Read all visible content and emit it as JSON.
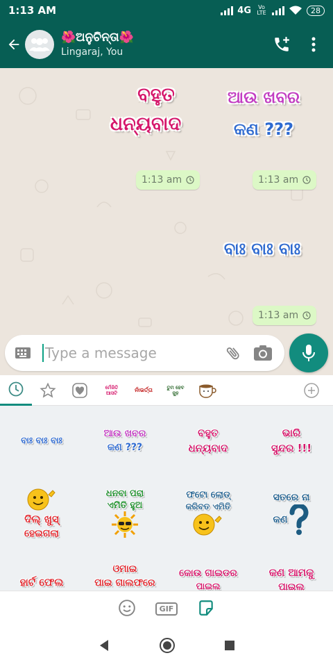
{
  "status_bar": {
    "time": "1:13 AM",
    "network": "4G",
    "volte": "Vo LTE",
    "battery": "28"
  },
  "header": {
    "group_name": "🌺ଅନୁଚିନ୍ତା🌺",
    "members": "Lingaraj, You"
  },
  "chat": {
    "stickers": [
      {
        "line1": "ବହୁତ",
        "line2": "ଧନ୍ୟବାଦ"
      },
      {
        "line1": "ଆଉ ଖବର",
        "line2": "କଣ ???"
      },
      {
        "line1": "ବାଃ ବାଃ ବାଃ"
      }
    ],
    "timestamps": [
      "1:13 am",
      "1:13 am",
      "1:13 am"
    ]
  },
  "composer": {
    "placeholder": "Type a message"
  },
  "tray": {
    "tab_labels": [
      {
        "line1": "ମେଁଜିତି",
        "line2": "ଆସଟି"
      },
      {
        "line1": "ନାଁଭର୍ତ୍ତା"
      },
      {
        "line1": "ତୁମ ହେବ",
        "line2": "ଜୁହ"
      }
    ],
    "grid": [
      {
        "line1": "ବାଃ ବାଃ ବାଃ"
      },
      {
        "line1": "ଆଉ ଖବର",
        "line2": "କଣ ???"
      },
      {
        "line1": "ବହୁତ",
        "line2": "ଧନ୍ୟବାଦ"
      },
      {
        "line1": "ଭାରି",
        "line2": "ସୁନ୍ଦର !!!"
      },
      {
        "line1": "ଦିଲ୍ ଖୁସ୍",
        "line2": "ହେଇଗଲା"
      },
      {
        "line1": "ଧନବା ପରା",
        "line2": "ଏମିତି ହୁଅ"
      },
      {
        "line1": "ଫଟୋ ଲୋଡ୍",
        "line2": "କରିବତ ଏମିତି"
      },
      {
        "line1": "ସତରେ ନା",
        "line2": "କଣ"
      },
      {
        "line1": "ହାର୍ଟ ଫେଲ"
      },
      {
        "line1": "ଓମାଇ",
        "line2": "ପାଇ ଗାଲଫରେ"
      },
      {
        "line1": "କୋଉ ଗାଇଡର",
        "line2": "ପାଇଲ"
      },
      {
        "line1": "କଣ ଆମକୁ",
        "line2": "ପାଇଲ"
      }
    ],
    "footer": {
      "gif_label": "GIF"
    }
  },
  "colors": {
    "primary": "#075e54",
    "accent": "#128c7e",
    "bubble": "#dcf8c6",
    "chat_bg": "#ece5dd"
  },
  "icons": [
    "back-arrow-icon",
    "group-avatar-icon",
    "add-call-icon",
    "more-vert-icon",
    "keyboard-icon",
    "attach-icon",
    "camera-icon",
    "mic-icon",
    "recent-icon",
    "star-icon",
    "heart-icon",
    "add-icon",
    "emoji-icon",
    "gif-icon",
    "sticker-icon",
    "nav-back-icon",
    "nav-home-icon",
    "nav-recents-icon"
  ]
}
